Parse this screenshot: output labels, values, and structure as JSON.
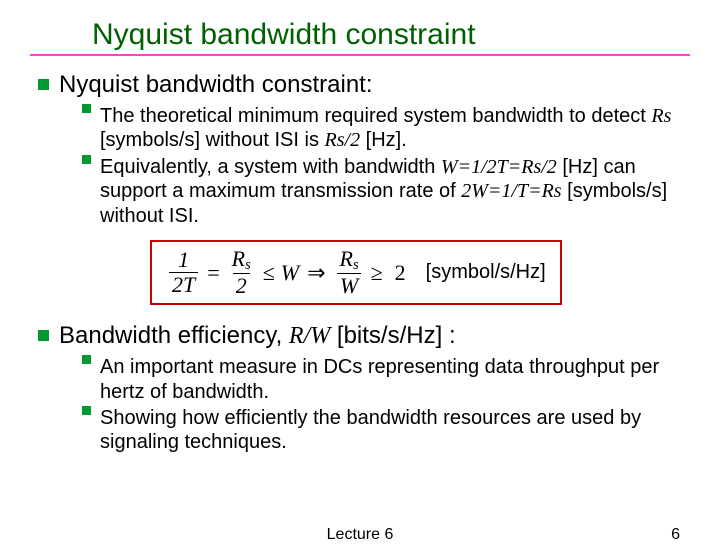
{
  "title": "Nyquist bandwidth constraint",
  "section1": {
    "heading": "Nyquist bandwidth constraint:",
    "p1a": "The theoretical minimum required system bandwidth to detect ",
    "p1b": " [symbols/s] without ISI is ",
    "p1c": " [Hz].",
    "rs": "Rs",
    "rs2": "Rs/2",
    "p2a": "Equivalently, a system with bandwidth ",
    "eq1": "W=1/2T=Rs/2",
    "p2b": " [Hz] can support a maximum transmission rate of ",
    "eq2": "2W=1/T=Rs",
    "p2c": " [symbols/s] without ISI."
  },
  "formula": {
    "f1n": "1",
    "f1d": "2T",
    "op1": "=",
    "f2n": "R",
    "f2sub": "s",
    "f2d": "2",
    "op2": "≤",
    "w": "W",
    "arrow": "⇒",
    "f3n": "R",
    "f3sub": "s",
    "f3d": "W",
    "op3": "≥",
    "two": "2",
    "unit": "[symbol/s/Hz]"
  },
  "section2": {
    "heading_a": "Bandwidth efficiency, ",
    "rw": "R/W",
    "heading_b": " [bits/s/Hz] :",
    "p1": "An important measure in DCs representing data throughput per hertz of bandwidth.",
    "p2": "Showing how efficiently the bandwidth resources are used by signaling techniques."
  },
  "footer": {
    "center": "Lecture 6",
    "right": "6"
  }
}
